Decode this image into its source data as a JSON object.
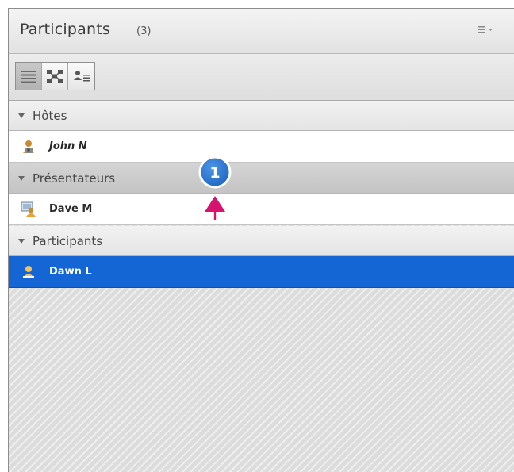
{
  "panel": {
    "title": "Participants",
    "count": "(3)",
    "menu_icon": "menu-list-icon"
  },
  "toolbar": {
    "buttons": [
      {
        "icon": "list-view-icon",
        "active": true
      },
      {
        "icon": "breakout-view-icon",
        "active": false
      },
      {
        "icon": "attendee-details-icon",
        "active": false
      }
    ]
  },
  "groups": [
    {
      "label": "Hôtes",
      "members": [
        {
          "name": "John N",
          "icon": "host-user-icon",
          "italic": true,
          "selected": false
        }
      ]
    },
    {
      "label": "Présentateurs",
      "members": [
        {
          "name": "Dave M",
          "icon": "presenter-user-icon",
          "italic": false,
          "selected": false
        }
      ]
    },
    {
      "label": "Participants",
      "members": [
        {
          "name": "Dawn L",
          "icon": "participant-user-icon",
          "italic": false,
          "selected": true
        }
      ]
    }
  ],
  "callout": {
    "number": "1",
    "color": "#1d65c1",
    "arrow_color": "#d6136f"
  },
  "colors": {
    "selection": "#1366d4"
  }
}
